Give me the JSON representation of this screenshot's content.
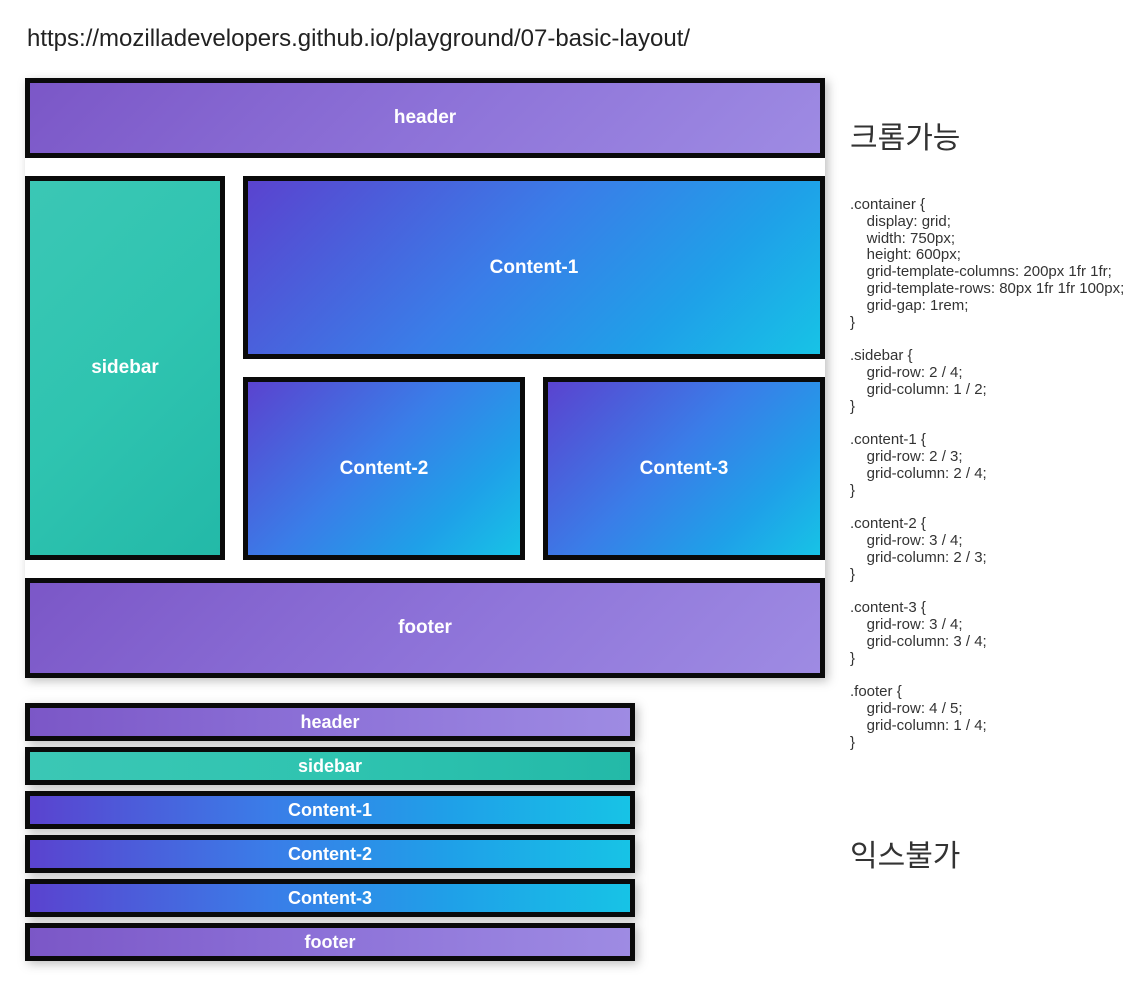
{
  "url": "https://mozilladevelopers.github.io/playground/07-basic-layout/",
  "grid": {
    "header": "header",
    "sidebar": "sidebar",
    "content1": "Content-1",
    "content2": "Content-2",
    "content3": "Content-3",
    "footer": "footer"
  },
  "stack": {
    "header": "header",
    "sidebar": "sidebar",
    "content1": "Content-1",
    "content2": "Content-2",
    "content3": "Content-3",
    "footer": "footer"
  },
  "right": {
    "heading1": "크롬가능",
    "heading2": "익스불가",
    "code": ".container {\n    display: grid;\n    width: 750px;\n    height: 600px;\n    grid-template-columns: 200px 1fr 1fr;\n    grid-template-rows: 80px 1fr 1fr 100px;\n    grid-gap: 1rem;\n}\n\n.sidebar {\n    grid-row: 2 / 4;\n    grid-column: 1 / 2;\n}\n\n.content-1 {\n    grid-row: 2 / 3;\n    grid-column: 2 / 4;\n}\n\n.content-2 {\n    grid-row: 3 / 4;\n    grid-column: 2 / 3;\n}\n\n.content-3 {\n    grid-row: 3 / 4;\n    grid-column: 3 / 4;\n}\n\n.footer {\n    grid-row: 4 / 5;\n    grid-column: 1 / 4;\n}"
  }
}
